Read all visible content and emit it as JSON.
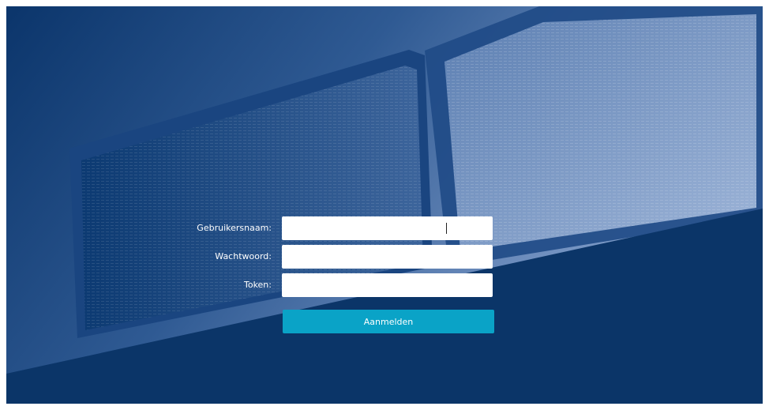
{
  "login": {
    "username_label": "Gebruikersnaam:",
    "username_value": "",
    "password_label": "Wachtwoord:",
    "password_value": "",
    "token_label": "Token:",
    "token_value": "",
    "submit_label": "Aanmelden"
  },
  "colors": {
    "background_dark": "#0d3a72",
    "background_light": "#7a97c2",
    "button": "#0aa3c7",
    "text": "#ffffff"
  }
}
